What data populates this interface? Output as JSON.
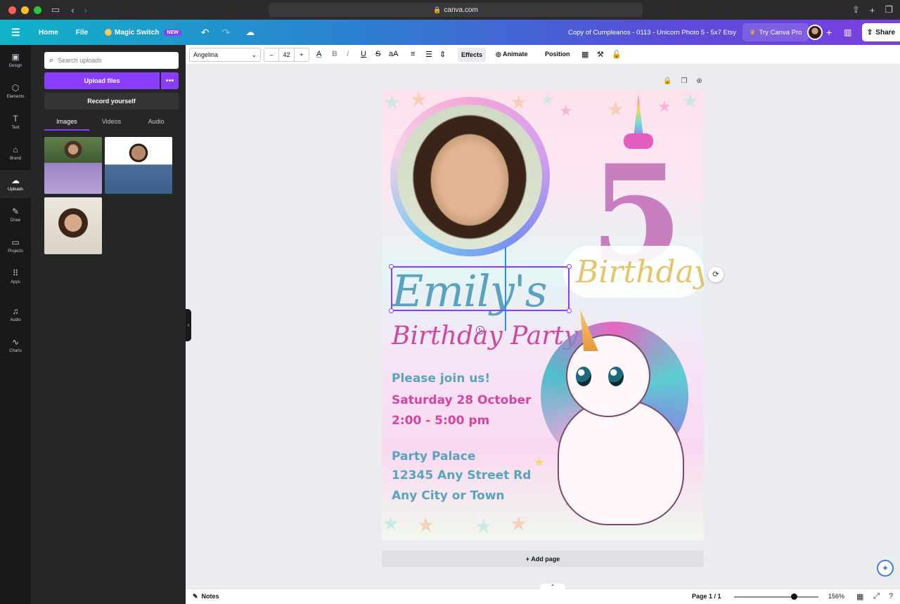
{
  "browser": {
    "url": "canva.com"
  },
  "topbar": {
    "home": "Home",
    "file": "File",
    "magic_switch": "Magic Switch",
    "new_badge": "NEW",
    "doc_title": "Copy of Cumpleanos - 0113 - Unicorn Photo 5 - 5x7 Etsy",
    "try_pro": "Try Canva Pro",
    "share": "Share"
  },
  "rail": {
    "items": [
      {
        "label": "Design",
        "icon": "▣"
      },
      {
        "label": "Elements",
        "icon": "⬡"
      },
      {
        "label": "Text",
        "icon": "T"
      },
      {
        "label": "Brand",
        "icon": "⌂"
      },
      {
        "label": "Uploads",
        "icon": "☁"
      },
      {
        "label": "Draw",
        "icon": "✎"
      },
      {
        "label": "Projects",
        "icon": "▭"
      },
      {
        "label": "Apps",
        "icon": "⠿"
      },
      {
        "label": "Audio",
        "icon": "♫"
      },
      {
        "label": "Charts",
        "icon": "∿"
      }
    ],
    "active": "Uploads"
  },
  "panel": {
    "search_placeholder": "Search uploads",
    "upload_files": "Upload files",
    "record_yourself": "Record yourself",
    "tabs": [
      "Images",
      "Videos",
      "Audio"
    ],
    "active_tab": "Images"
  },
  "toolbar": {
    "font": "Angelina",
    "size": "42",
    "minus": "–",
    "plus": "+",
    "effects": "Effects",
    "animate": "Animate",
    "position": "Position"
  },
  "design": {
    "name": "Emily's",
    "birthday_gold": "Birthday",
    "party_title": "Birthday Party",
    "number": "5",
    "lines": [
      {
        "text": "Please join us!",
        "color": "#5aa3bd"
      },
      {
        "text": "Saturday 28 October",
        "color": "#d7449e"
      },
      {
        "text": "2:00 - 5:00 pm",
        "color": "#d7449e"
      },
      {
        "text": "Party Palace",
        "color": "#5aa3bd"
      },
      {
        "text": "12345 Any Street Rd",
        "color": "#5aa3bd"
      },
      {
        "text": "Any City or Town",
        "color": "#5aa3bd"
      }
    ]
  },
  "canvas": {
    "add_page": "+ Add page"
  },
  "footer": {
    "notes": "Notes",
    "page": "Page 1 / 1",
    "zoom": "156%"
  },
  "colors": {
    "accent": "#8b3dff",
    "header_start": "#11b2c8",
    "header_end": "#7b3fe0"
  }
}
